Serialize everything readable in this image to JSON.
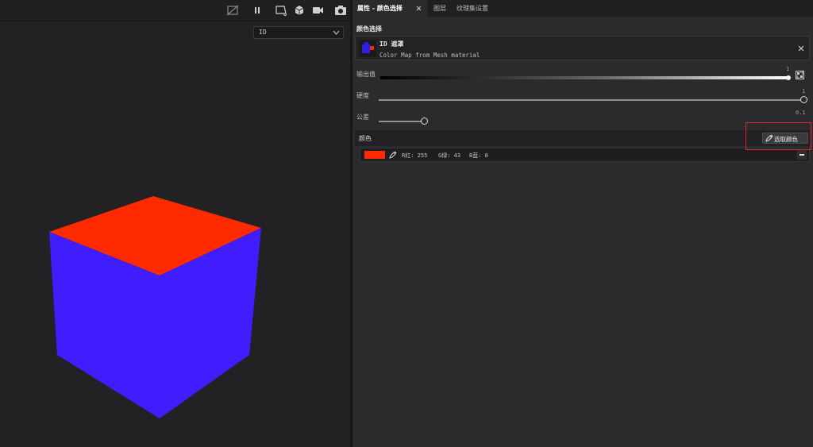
{
  "viewport": {
    "toolbar_icons": [
      "hide-grid-icon",
      "pause-icon",
      "frame-icon",
      "cube-view-icon",
      "camera-icon",
      "screenshot-icon"
    ],
    "display_select": {
      "value": "ID"
    },
    "cube_colors": {
      "top": "#ff2a00",
      "sides": "#3f1dfc"
    }
  },
  "tabs": [
    {
      "label": "属性 - 颜色选择",
      "active": true
    },
    {
      "label": "图层",
      "active": false
    },
    {
      "label": "纹理集设置",
      "active": false
    }
  ],
  "panel": {
    "section_title": "颜色选择",
    "mask": {
      "name": "ID 遮罩",
      "description": "Color Map from Mesh material"
    },
    "params": {
      "output": {
        "label": "输出值",
        "value": "1",
        "level": 1.0
      },
      "hardness": {
        "label": "硬度",
        "value": "1",
        "level": 1.0
      },
      "tolerance": {
        "label": "公差",
        "value": "0.1",
        "level": 0.1
      }
    },
    "color": {
      "title": "颜色",
      "pick_button": "选取颜色",
      "swatch_color": "#ff2a00",
      "r_text": "R红: 255",
      "g_text": "G绿: 43",
      "b_text": "B蓝: 0"
    }
  },
  "colors": {
    "highlight": "#e02626",
    "panel_bg": "#2b2b2d",
    "viewport_bg": "#222224"
  }
}
